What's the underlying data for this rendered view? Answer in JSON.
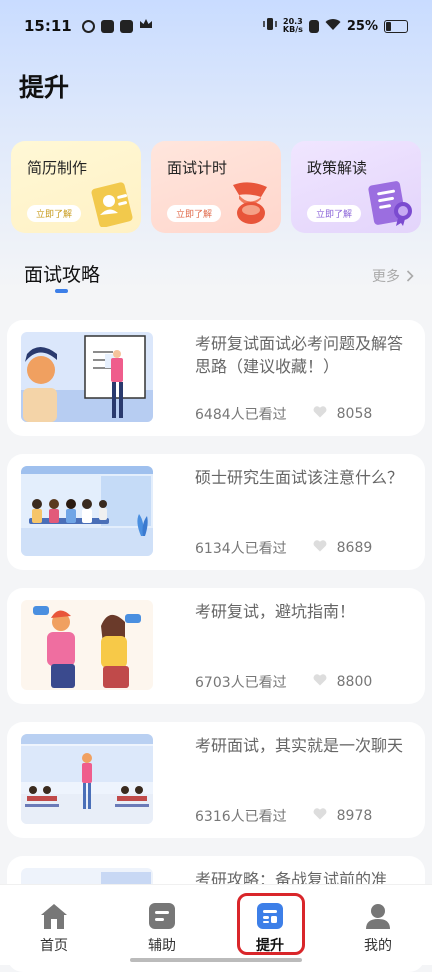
{
  "status_bar": {
    "time": "15:11",
    "net_speed_top": "20.3",
    "net_speed_bottom": "KB/s",
    "battery_percent": "25%"
  },
  "page": {
    "title": "提升"
  },
  "features": [
    {
      "title": "简历制作",
      "button": "立即了解",
      "icon": "resume-icon"
    },
    {
      "title": "面试计时",
      "button": "立即了解",
      "icon": "timer-icon"
    },
    {
      "title": "政策解读",
      "button": "立即了解",
      "icon": "policy-certificate-icon"
    }
  ],
  "section": {
    "title": "面试攻略",
    "more": "更多"
  },
  "articles": [
    {
      "title": "考研复试面试必考问题及解答思路（建议收藏！）",
      "views": "6484人已看过",
      "likes": "8058"
    },
    {
      "title": "硕士研究生面试该注意什么？",
      "views": "6134人已看过",
      "likes": "8689"
    },
    {
      "title": "考研复试，避坑指南！",
      "views": "6703人已看过",
      "likes": "8800"
    },
    {
      "title": "考研面试，其实就是一次聊天",
      "views": "6316人已看过",
      "likes": "8978"
    },
    {
      "title": "考研攻略：备战复试前的准",
      "views": "",
      "likes": ""
    }
  ],
  "nav": {
    "items": [
      {
        "label": "首页",
        "icon": "home-icon"
      },
      {
        "label": "辅助",
        "icon": "assist-icon"
      },
      {
        "label": "提升",
        "icon": "improve-icon"
      },
      {
        "label": "我的",
        "icon": "profile-icon"
      }
    ],
    "active_index": 2
  },
  "colors": {
    "accent": "#3d7fe8",
    "highlight_ring": "#d9262a"
  }
}
